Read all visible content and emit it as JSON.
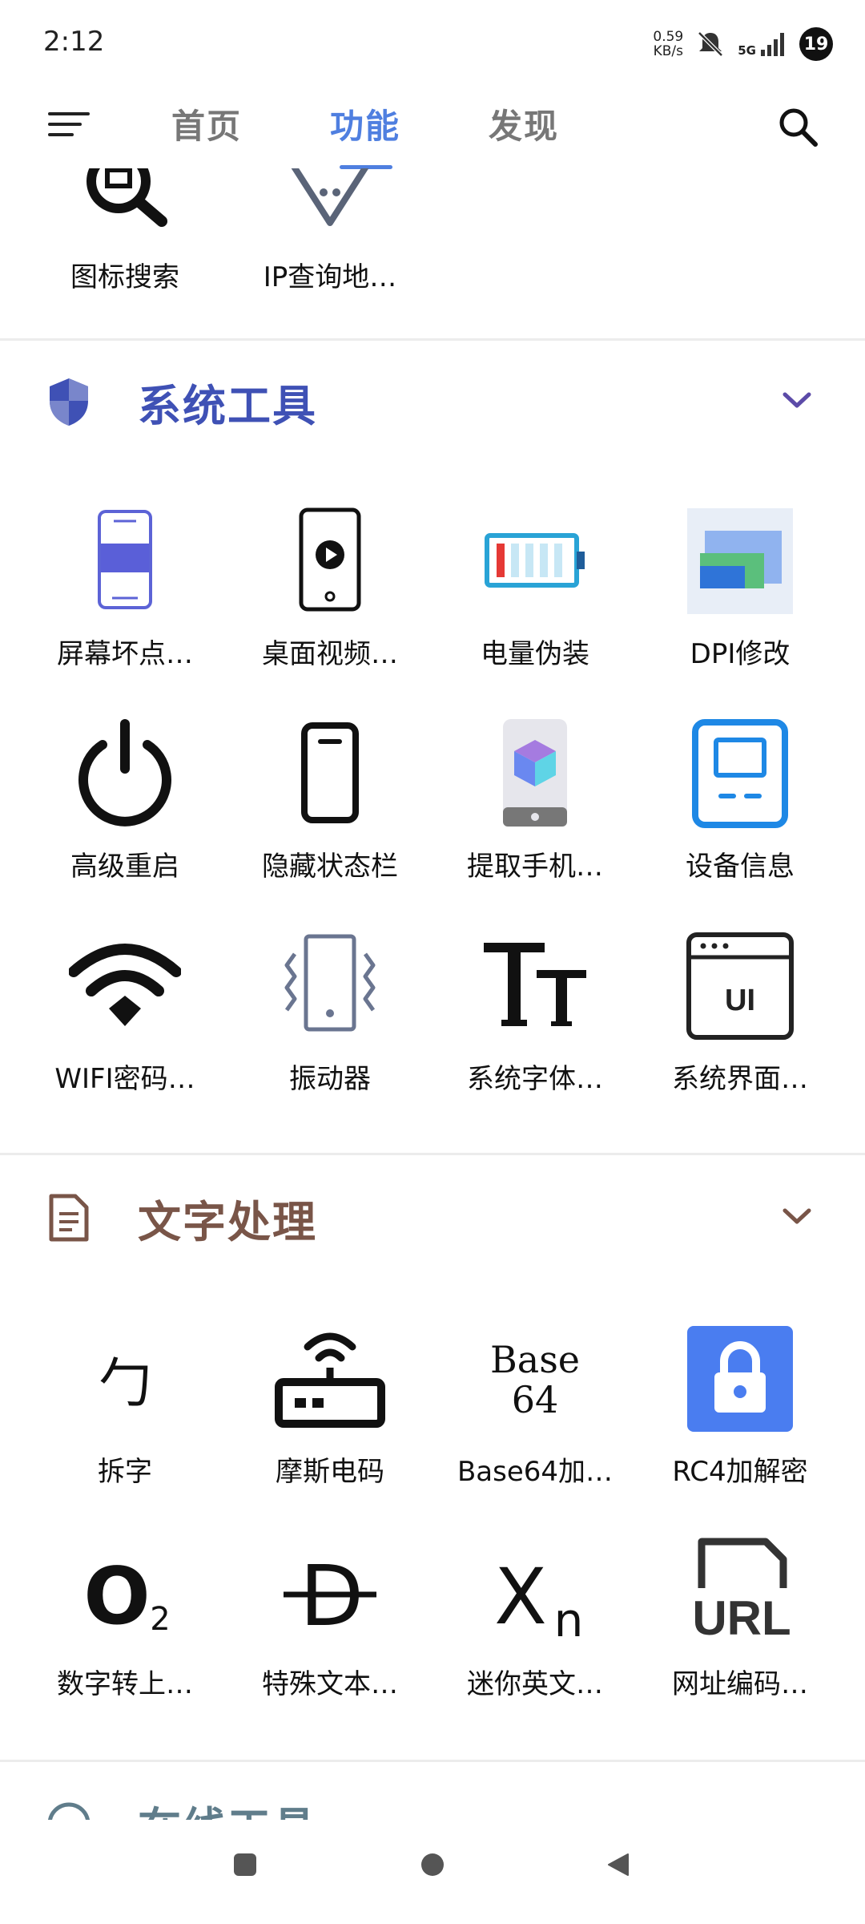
{
  "status": {
    "time": "2:12",
    "netspeed_value": "0.59",
    "netspeed_unit": "KB/s",
    "network": "5G",
    "battery": "19"
  },
  "tabs": [
    {
      "label": "首页"
    },
    {
      "label": "功能"
    },
    {
      "label": "发现"
    }
  ],
  "partial_row": [
    {
      "label": "图标搜索",
      "icon": "image-search-icon"
    },
    {
      "label": "IP查询地…",
      "icon": "location-shield-icon"
    }
  ],
  "sections": [
    {
      "title": "系统工具",
      "icon": "shield-icon",
      "color": "#3f51b5",
      "items": [
        {
          "label": "屏幕坏点…",
          "icon": "screen-pixel-icon"
        },
        {
          "label": "桌面视频…",
          "icon": "phone-video-icon"
        },
        {
          "label": "电量伪装",
          "icon": "battery-icon"
        },
        {
          "label": "DPI修改",
          "icon": "dpi-window-icon"
        },
        {
          "label": "高级重启",
          "icon": "power-icon"
        },
        {
          "label": "隐藏状态栏",
          "icon": "phone-statusbar-icon"
        },
        {
          "label": "提取手机…",
          "icon": "phone-cube-icon"
        },
        {
          "label": "设备信息",
          "icon": "device-info-icon"
        },
        {
          "label": "WIFI密码…",
          "icon": "wifi-icon"
        },
        {
          "label": "振动器",
          "icon": "vibration-icon"
        },
        {
          "label": "系统字体…",
          "icon": "font-tt-icon"
        },
        {
          "label": "系统界面…",
          "icon": "ui-window-icon"
        }
      ]
    },
    {
      "title": "文字处理",
      "icon": "document-icon",
      "color": "#795548",
      "items": [
        {
          "label": "拆字",
          "icon": "character-split-icon",
          "glyph": "勹"
        },
        {
          "label": "摩斯电码",
          "icon": "router-icon"
        },
        {
          "label": "Base64加…",
          "icon": "base64-icon",
          "glyph1": "Base",
          "glyph2": "64"
        },
        {
          "label": "RC4加解密",
          "icon": "lock-icon"
        },
        {
          "label": "数字转上…",
          "icon": "subscript-o2-icon",
          "glyph1": "O",
          "glyph2": "2"
        },
        {
          "label": "特殊文本…",
          "icon": "strike-d-icon",
          "glyph": "D"
        },
        {
          "label": "迷你英文…",
          "icon": "subscript-xn-icon",
          "glyph1": "X",
          "glyph2": "n"
        },
        {
          "label": "网址编码…",
          "icon": "url-file-icon",
          "glyph": "URL"
        }
      ]
    },
    {
      "title": "在线工具",
      "icon": "globe-icon",
      "color": "#607d8b"
    }
  ]
}
